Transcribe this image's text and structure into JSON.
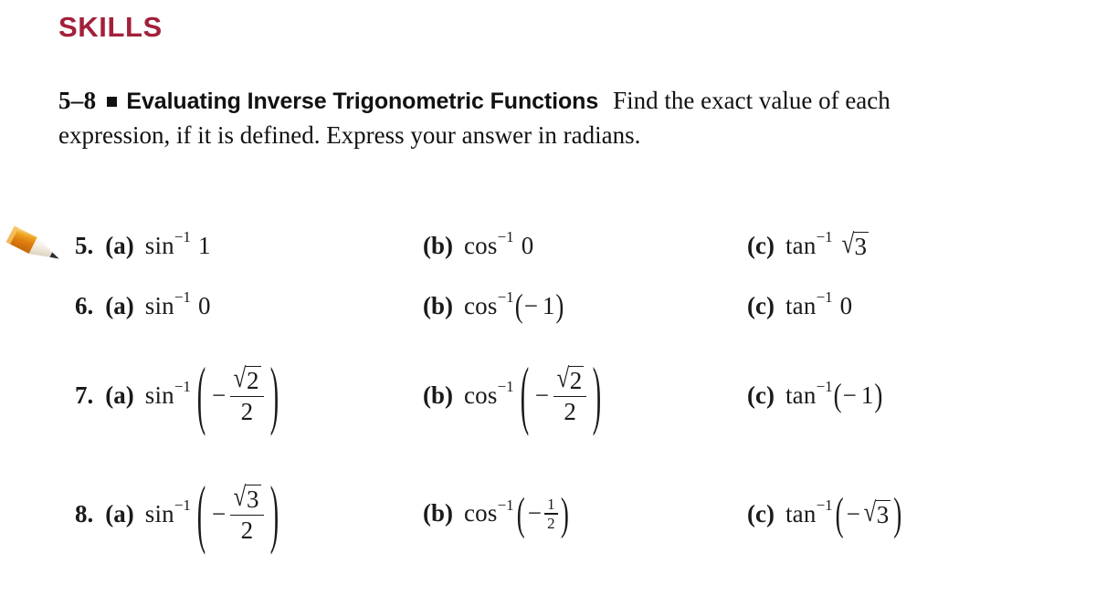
{
  "heading": {
    "label": "SKILLS"
  },
  "instructions": {
    "range": "5–8",
    "bullet_icon": "filled-square-bullet",
    "topic": "Evaluating Inverse Trigonometric Functions",
    "body": "Find the exact value of each expression, if it is defined. Express your answer in radians."
  },
  "pencil_icon": {
    "name": "pencil-icon",
    "body_color": "#e89a1c",
    "wood_color": "#f0e6d2",
    "tip_color": "#2b2b2b"
  },
  "exercises": [
    {
      "number": "5.",
      "parts": [
        {
          "label": "(a)",
          "fn": "sin",
          "exp": "−1",
          "arg": "1",
          "form": "plain"
        },
        {
          "label": "(b)",
          "fn": "cos",
          "exp": "−1",
          "arg": "0",
          "form": "plain"
        },
        {
          "label": "(c)",
          "fn": "tan",
          "exp": "−1",
          "arg": "3",
          "form": "sqrt"
        }
      ]
    },
    {
      "number": "6.",
      "parts": [
        {
          "label": "(a)",
          "fn": "sin",
          "exp": "−1",
          "arg": "0",
          "form": "plain"
        },
        {
          "label": "(b)",
          "fn": "cos",
          "exp": "−1",
          "arg": "1",
          "form": "paren-neg"
        },
        {
          "label": "(c)",
          "fn": "tan",
          "exp": "−1",
          "arg": "0",
          "form": "plain"
        }
      ]
    },
    {
      "number": "7.",
      "parts": [
        {
          "label": "(a)",
          "fn": "sin",
          "exp": "−1",
          "numer": "2",
          "denom": "2",
          "form": "paren-neg-sqrt-frac"
        },
        {
          "label": "(b)",
          "fn": "cos",
          "exp": "−1",
          "numer": "2",
          "denom": "2",
          "form": "paren-neg-sqrt-frac"
        },
        {
          "label": "(c)",
          "fn": "tan",
          "exp": "−1",
          "arg": "1",
          "form": "paren-neg"
        }
      ]
    },
    {
      "number": "8.",
      "parts": [
        {
          "label": "(a)",
          "fn": "sin",
          "exp": "−1",
          "numer": "3",
          "denom": "2",
          "form": "paren-neg-sqrt-frac"
        },
        {
          "label": "(b)",
          "fn": "cos",
          "exp": "−1",
          "numer": "1",
          "denom": "2",
          "form": "paren-neg-smallfrac"
        },
        {
          "label": "(c)",
          "fn": "tan",
          "exp": "−1",
          "arg": "3",
          "form": "paren-neg-sqrt"
        }
      ]
    }
  ],
  "symbols": {
    "radical": "√",
    "minus": "−",
    "paren_open": "(",
    "paren_close": ")"
  }
}
